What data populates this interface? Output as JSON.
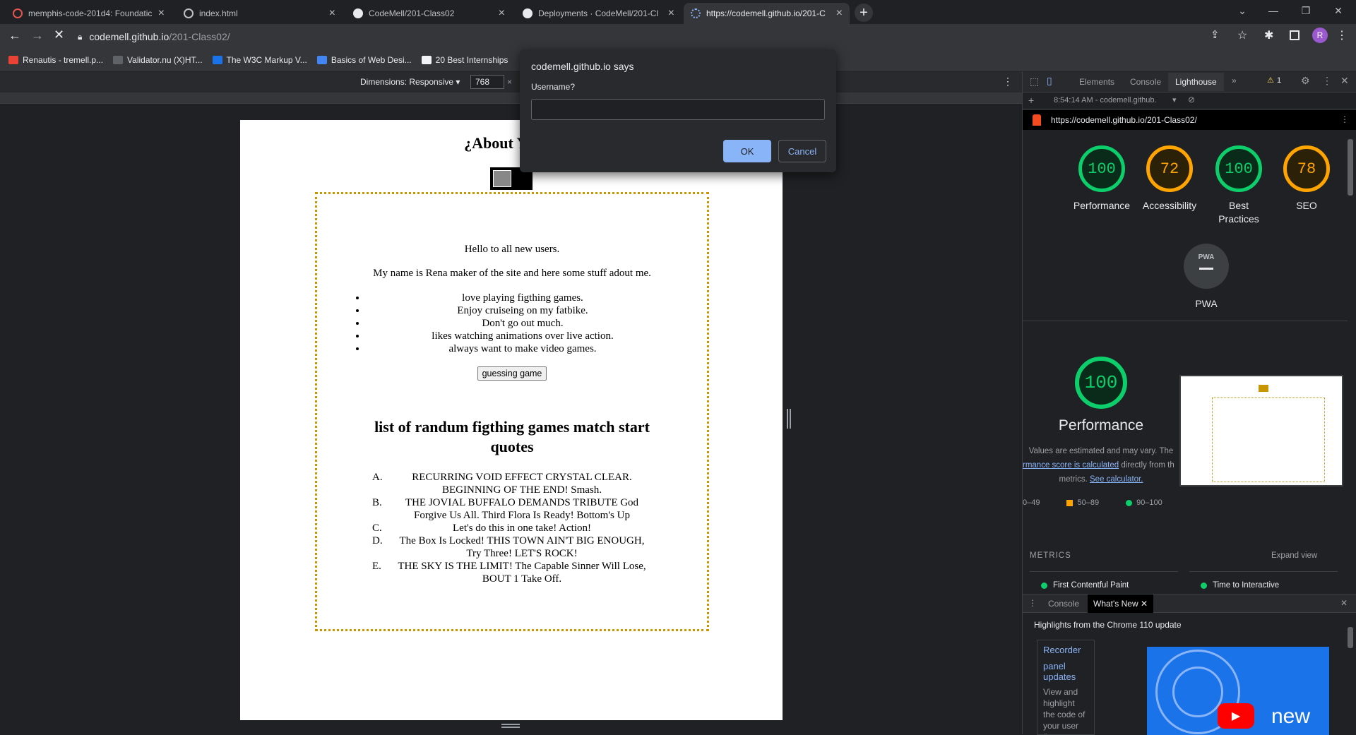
{
  "tabs": [
    {
      "title": "memphis-code-201d4: Foundatic",
      "fav": "#e5554f"
    },
    {
      "title": "index.html",
      "fav": "#bdc1c6"
    },
    {
      "title": "CodeMell/201-Class02",
      "fav": "#e8eaed"
    },
    {
      "title": "Deployments · CodeMell/201-Cl",
      "fav": "#e8eaed"
    },
    {
      "title": "https://codemell.github.io/201-C",
      "fav": "#e8eaed"
    }
  ],
  "address": {
    "host": "codemell.github.io",
    "path": "/201-Class02/"
  },
  "bookmarks": [
    "Renautis - tremell.p...",
    "Validator.nu (X)HT...",
    "The W3C Markup V...",
    "Basics of Web Desi...",
    "20 Best Internships"
  ],
  "bookmark_colors": [
    "#ea4335",
    "#5f6368",
    "#1a73e8",
    "#4285f4",
    "#f1f3f4"
  ],
  "device": {
    "label": "Dimensions: Responsive ▾",
    "width": "768",
    "times": "×"
  },
  "page": {
    "title": "¿About You K",
    "greeting": "Hello to all new users.",
    "intro": "My name is Rena maker of the site and here some stuff adout me.",
    "likes": [
      "love playing figthing games.",
      "Enjoy cruiseing on my fatbike.",
      "Don't go out much.",
      "likes watching animations over live action.",
      "always want to make video games."
    ],
    "button": "guessing game",
    "heading": "list of randum figthing games match start quotes",
    "quotes": [
      {
        "m": "A.",
        "t": "RECURRING VOID EFFECT CRYSTAL CLEAR. BEGINNING OF THE END! Smash."
      },
      {
        "m": "B.",
        "t": "THE JOVIAL BUFFALO DEMANDS TRIBUTE God Forgive Us All. Third Flora Is Ready! Bottom's Up"
      },
      {
        "m": "C.",
        "t": "Let's do this in one take! Action!"
      },
      {
        "m": "D.",
        "t": "The Box Is Locked! THIS TOWN AIN'T BIG ENOUGH, Try Three! LET'S ROCK!"
      },
      {
        "m": "E.",
        "t": "THE SKY IS THE LIMIT! The Capable Sinner Will Lose, BOUT 1 Take Off."
      }
    ]
  },
  "dialog": {
    "title": "codemell.github.io says",
    "label": "Username?",
    "value": "",
    "ok": "OK",
    "cancel": "Cancel"
  },
  "devtools": {
    "tabs": [
      "Elements",
      "Console",
      "Lighthouse"
    ],
    "warn_count": "1",
    "report_time": "8:54:14 AM - codemell.github.",
    "url": "https://codemell.github.io/201-Class02/",
    "scores": [
      {
        "value": "100",
        "label": "Performance",
        "color": "green"
      },
      {
        "value": "72",
        "label": "Accessibility",
        "color": "orange"
      },
      {
        "value": "100",
        "label": "Best Practices",
        "color": "green"
      },
      {
        "value": "78",
        "label": "SEO",
        "color": "orange"
      }
    ],
    "pwa": {
      "badge": "PWA",
      "label": "PWA"
    },
    "perf": {
      "score": "100",
      "title": "Performance",
      "note1": "Values are estimated and may vary. The",
      "note_link": "rmance score is calculated",
      "note2": "directly from th",
      "note3": "metrics.",
      "calc_link": "See calculator."
    },
    "legend": [
      "0–49",
      "50–89",
      "90–100"
    ],
    "metrics_label": "METRICS",
    "expand": "Expand view",
    "metric_items": [
      "First Contentful Paint",
      "Time to Interactive"
    ],
    "drawer": {
      "tabs": [
        "Console",
        "What's New"
      ],
      "highlight": "Highlights from the Chrome 110 update",
      "card_title": "Recorder",
      "card_link": "panel updates",
      "card_text": "View and highlight the code of your user flow instantly and",
      "video_word": "new"
    }
  }
}
